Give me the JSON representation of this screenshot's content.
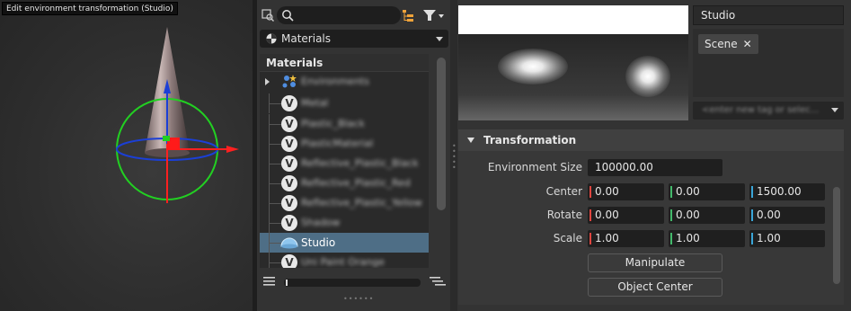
{
  "viewport": {
    "tooltip": "Edit environment transformation (Studio)"
  },
  "tree_panel": {
    "search": {
      "placeholder": ""
    },
    "combo": {
      "value": "Materials"
    },
    "tree_header": "Materials",
    "items": [
      {
        "label": "Environments",
        "kind": "environments"
      },
      {
        "label": "Metal",
        "kind": "material"
      },
      {
        "label": "Plastic_Black",
        "kind": "material"
      },
      {
        "label": "PlasticMaterial",
        "kind": "material"
      },
      {
        "label": "Reflective_Plastic_Black",
        "kind": "material"
      },
      {
        "label": "Reflective_Plastic_Red",
        "kind": "material"
      },
      {
        "label": "Reflective_Plastic_Yellow",
        "kind": "material"
      },
      {
        "label": "Shadow",
        "kind": "material"
      },
      {
        "label": "Studio",
        "kind": "environment",
        "selected": true
      },
      {
        "label": "Uni Paint Orange",
        "kind": "material"
      }
    ]
  },
  "right_panel": {
    "name_field": "Studio",
    "tags": [
      {
        "label": "Scene",
        "remove": "✕"
      }
    ],
    "tag_input_placeholder": "<enter new tag or selec...",
    "section_title": "Transformation",
    "environment_size": {
      "label": "Environment Size",
      "value": "100000.00"
    },
    "center": {
      "label": "Center",
      "x": "0.00",
      "y": "0.00",
      "z": "1500.00"
    },
    "rotate": {
      "label": "Rotate",
      "x": "0.00",
      "y": "0.00",
      "z": "0.00"
    },
    "scale": {
      "label": "Scale",
      "x": "1.00",
      "y": "1.00",
      "z": "1.00"
    },
    "buttons": {
      "manipulate": "Manipulate",
      "object_center": "Object Center"
    }
  },
  "colors": {
    "x_axis": "#e0453f",
    "y_axis": "#43b96b",
    "z_axis": "#3aa6d8",
    "selection": "#4e6e86"
  }
}
